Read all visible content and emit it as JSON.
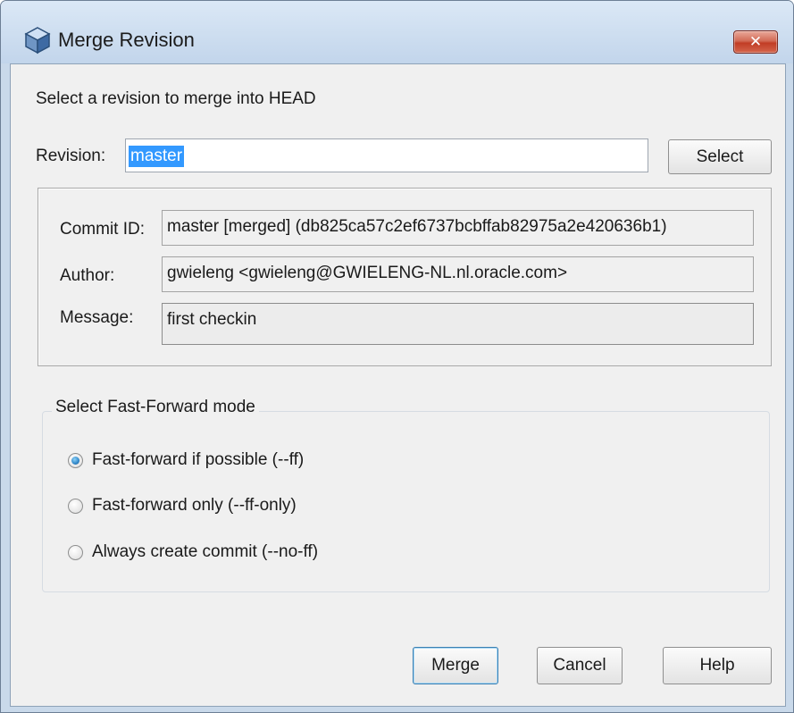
{
  "window": {
    "title": "Merge Revision",
    "close_label": "✕",
    "icon": "cube-icon"
  },
  "dialog": {
    "heading": "Select a revision to merge into HEAD",
    "revision_label": "Revision:",
    "revision_value": "master",
    "select_label": "Select"
  },
  "info": {
    "commit_id_label": "Commit ID:",
    "commit_id_value": "master [merged] (db825ca57c2ef6737bcbffab82975a2e420636b1)",
    "author_label": "Author:",
    "author_value": "gwieleng <gwieleng@GWIELENG-NL.nl.oracle.com>",
    "message_label": "Message:",
    "message_value": "first checkin"
  },
  "fast_forward": {
    "legend": "Select Fast-Forward mode",
    "options": [
      {
        "label": "Fast-forward if possible (--ff)",
        "checked": true
      },
      {
        "label": "Fast-forward only (--ff-only)",
        "checked": false
      },
      {
        "label": "Always create commit (--no-ff)",
        "checked": false
      }
    ]
  },
  "buttons": {
    "merge": "Merge",
    "cancel": "Cancel",
    "help": "Help"
  },
  "colors": {
    "selection": "#3399ff",
    "close_button": "#c13d25",
    "title_bar": "#c9d9ea"
  }
}
